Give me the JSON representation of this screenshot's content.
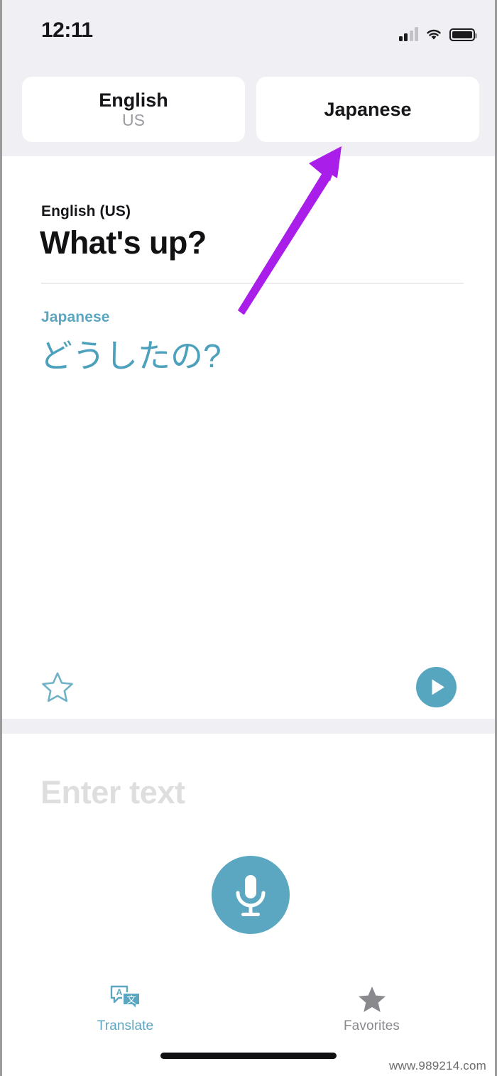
{
  "status_bar": {
    "time": "12:11",
    "signal_icon": "cellular-signal-icon",
    "wifi_icon": "wifi-icon",
    "battery_icon": "battery-full-icon"
  },
  "language_selector": {
    "source": {
      "name": "English",
      "region": "US"
    },
    "target": {
      "name": "Japanese",
      "region": ""
    }
  },
  "result": {
    "source_label": "English (US)",
    "source_text": "What's up?",
    "target_label": "Japanese",
    "target_text": "どうしたの?",
    "favorite_icon": "star-outline-icon",
    "play_icon": "play-icon"
  },
  "input": {
    "placeholder": "Enter text",
    "mic_icon": "microphone-icon"
  },
  "tab_bar": {
    "tabs": [
      {
        "label": "Translate",
        "icon": "translate-bubbles-icon",
        "active": true
      },
      {
        "label": "Favorites",
        "icon": "star-filled-icon",
        "active": false
      }
    ]
  },
  "annotation": {
    "arrow_icon": "arrow-pointing-up-right-icon",
    "color": "#aa1eea"
  },
  "watermark": {
    "text": "www.989214.com"
  },
  "colors": {
    "accent_teal": "#5ba6c0",
    "target_text": "#4ea1bc",
    "header_bg": "#f0f0f4",
    "card_bg": "#ffffff",
    "primary_text": "#16161a",
    "muted_text": "#9c9ca3",
    "placeholder": "#dededf",
    "inactive_tab": "#8a8a8e",
    "annotation_purple": "#aa1eea"
  }
}
